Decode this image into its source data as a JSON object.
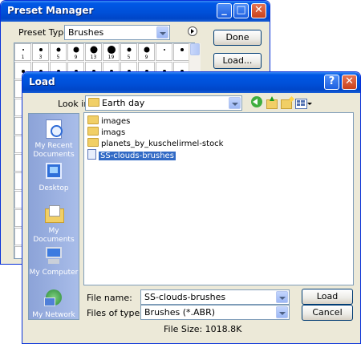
{
  "preset_manager": {
    "title": "Preset Manager",
    "preset_type_label": "Preset Type:",
    "preset_type_value": "Brushes",
    "buttons": {
      "done": "Done",
      "load": "Load..."
    },
    "brush_sizes": [
      "1",
      "3",
      "5",
      "9",
      "13",
      "19",
      "5",
      "9"
    ]
  },
  "load_dialog": {
    "title": "Load",
    "look_in_label": "Look in:",
    "look_in_value": "Earth day",
    "places": [
      {
        "label": "My Recent\nDocuments",
        "icon": "recent-documents-icon"
      },
      {
        "label": "Desktop",
        "icon": "desktop-icon"
      },
      {
        "label": "My Documents",
        "icon": "my-documents-icon"
      },
      {
        "label": "My Computer",
        "icon": "my-computer-icon"
      },
      {
        "label": "My Network",
        "icon": "my-network-icon"
      }
    ],
    "files": [
      {
        "name": "images",
        "type": "folder"
      },
      {
        "name": "imags",
        "type": "folder"
      },
      {
        "name": "planets_by_kuschelirmel-stock",
        "type": "folder"
      },
      {
        "name": "SS-clouds-brushes",
        "type": "file",
        "selected": true
      }
    ],
    "file_name_label": "File name:",
    "file_name_value": "SS-clouds-brushes",
    "files_of_type_label": "Files of type:",
    "files_of_type_value": "Brushes (*.ABR)",
    "file_size_text": "File Size: 1018.8K",
    "buttons": {
      "load": "Load",
      "cancel": "Cancel"
    },
    "caption_help": "?",
    "caption_close": "X"
  },
  "colors": {
    "titlebar": "#0054e3",
    "selection": "#316ac5",
    "dialog_bg": "#ece9d8"
  }
}
